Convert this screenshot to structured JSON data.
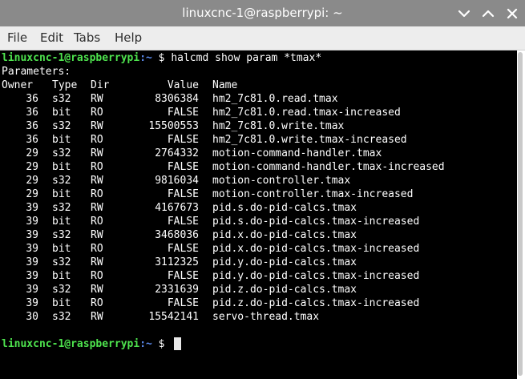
{
  "window": {
    "title": "linuxcnc-1@raspberrypi: ~",
    "buttons": [
      "chevron-down-icon",
      "chevron-up-icon",
      "close-icon"
    ]
  },
  "menu": {
    "items": [
      "File",
      "Edit",
      "Tabs",
      "Help"
    ]
  },
  "terminal": {
    "prompt_user_host": "linuxcnc-1@raspberrypi",
    "prompt_path": ":~",
    "prompt_symbol": " $",
    "command": " halcmd show param *tmax*",
    "parameters_label": "Parameters:",
    "headers": {
      "owner": "Owner",
      "type": "Type",
      "dir": "Dir",
      "value": "Value",
      "name": "Name"
    },
    "rows": [
      {
        "owner": "36",
        "type": "s32",
        "dir": "RW",
        "value": "8306384",
        "name": "hm2_7c81.0.read.tmax"
      },
      {
        "owner": "36",
        "type": "bit",
        "dir": "RO",
        "value": "FALSE",
        "name": "hm2_7c81.0.read.tmax-increased"
      },
      {
        "owner": "36",
        "type": "s32",
        "dir": "RW",
        "value": "15500553",
        "name": "hm2_7c81.0.write.tmax"
      },
      {
        "owner": "36",
        "type": "bit",
        "dir": "RO",
        "value": "FALSE",
        "name": "hm2_7c81.0.write.tmax-increased"
      },
      {
        "owner": "29",
        "type": "s32",
        "dir": "RW",
        "value": "2764332",
        "name": "motion-command-handler.tmax"
      },
      {
        "owner": "29",
        "type": "bit",
        "dir": "RO",
        "value": "FALSE",
        "name": "motion-command-handler.tmax-increased"
      },
      {
        "owner": "29",
        "type": "s32",
        "dir": "RW",
        "value": "9816034",
        "name": "motion-controller.tmax"
      },
      {
        "owner": "29",
        "type": "bit",
        "dir": "RO",
        "value": "FALSE",
        "name": "motion-controller.tmax-increased"
      },
      {
        "owner": "39",
        "type": "s32",
        "dir": "RW",
        "value": "4167673",
        "name": "pid.s.do-pid-calcs.tmax"
      },
      {
        "owner": "39",
        "type": "bit",
        "dir": "RO",
        "value": "FALSE",
        "name": "pid.s.do-pid-calcs.tmax-increased"
      },
      {
        "owner": "39",
        "type": "s32",
        "dir": "RW",
        "value": "3468036",
        "name": "pid.x.do-pid-calcs.tmax"
      },
      {
        "owner": "39",
        "type": "bit",
        "dir": "RO",
        "value": "FALSE",
        "name": "pid.x.do-pid-calcs.tmax-increased"
      },
      {
        "owner": "39",
        "type": "s32",
        "dir": "RW",
        "value": "3112325",
        "name": "pid.y.do-pid-calcs.tmax"
      },
      {
        "owner": "39",
        "type": "bit",
        "dir": "RO",
        "value": "FALSE",
        "name": "pid.y.do-pid-calcs.tmax-increased"
      },
      {
        "owner": "39",
        "type": "s32",
        "dir": "RW",
        "value": "2331639",
        "name": "pid.z.do-pid-calcs.tmax"
      },
      {
        "owner": "39",
        "type": "bit",
        "dir": "RO",
        "value": "FALSE",
        "name": "pid.z.do-pid-calcs.tmax-increased"
      },
      {
        "owner": "30",
        "type": "s32",
        "dir": "RW",
        "value": "15542141",
        "name": "servo-thread.tmax"
      }
    ]
  },
  "colors": {
    "titlebar": "#8a8a8a",
    "menubar": "#ededed",
    "terminal_bg": "#000000",
    "terminal_fg": "#ffffff",
    "prompt_user": "#4ee44e",
    "prompt_path": "#5c8cf0"
  }
}
